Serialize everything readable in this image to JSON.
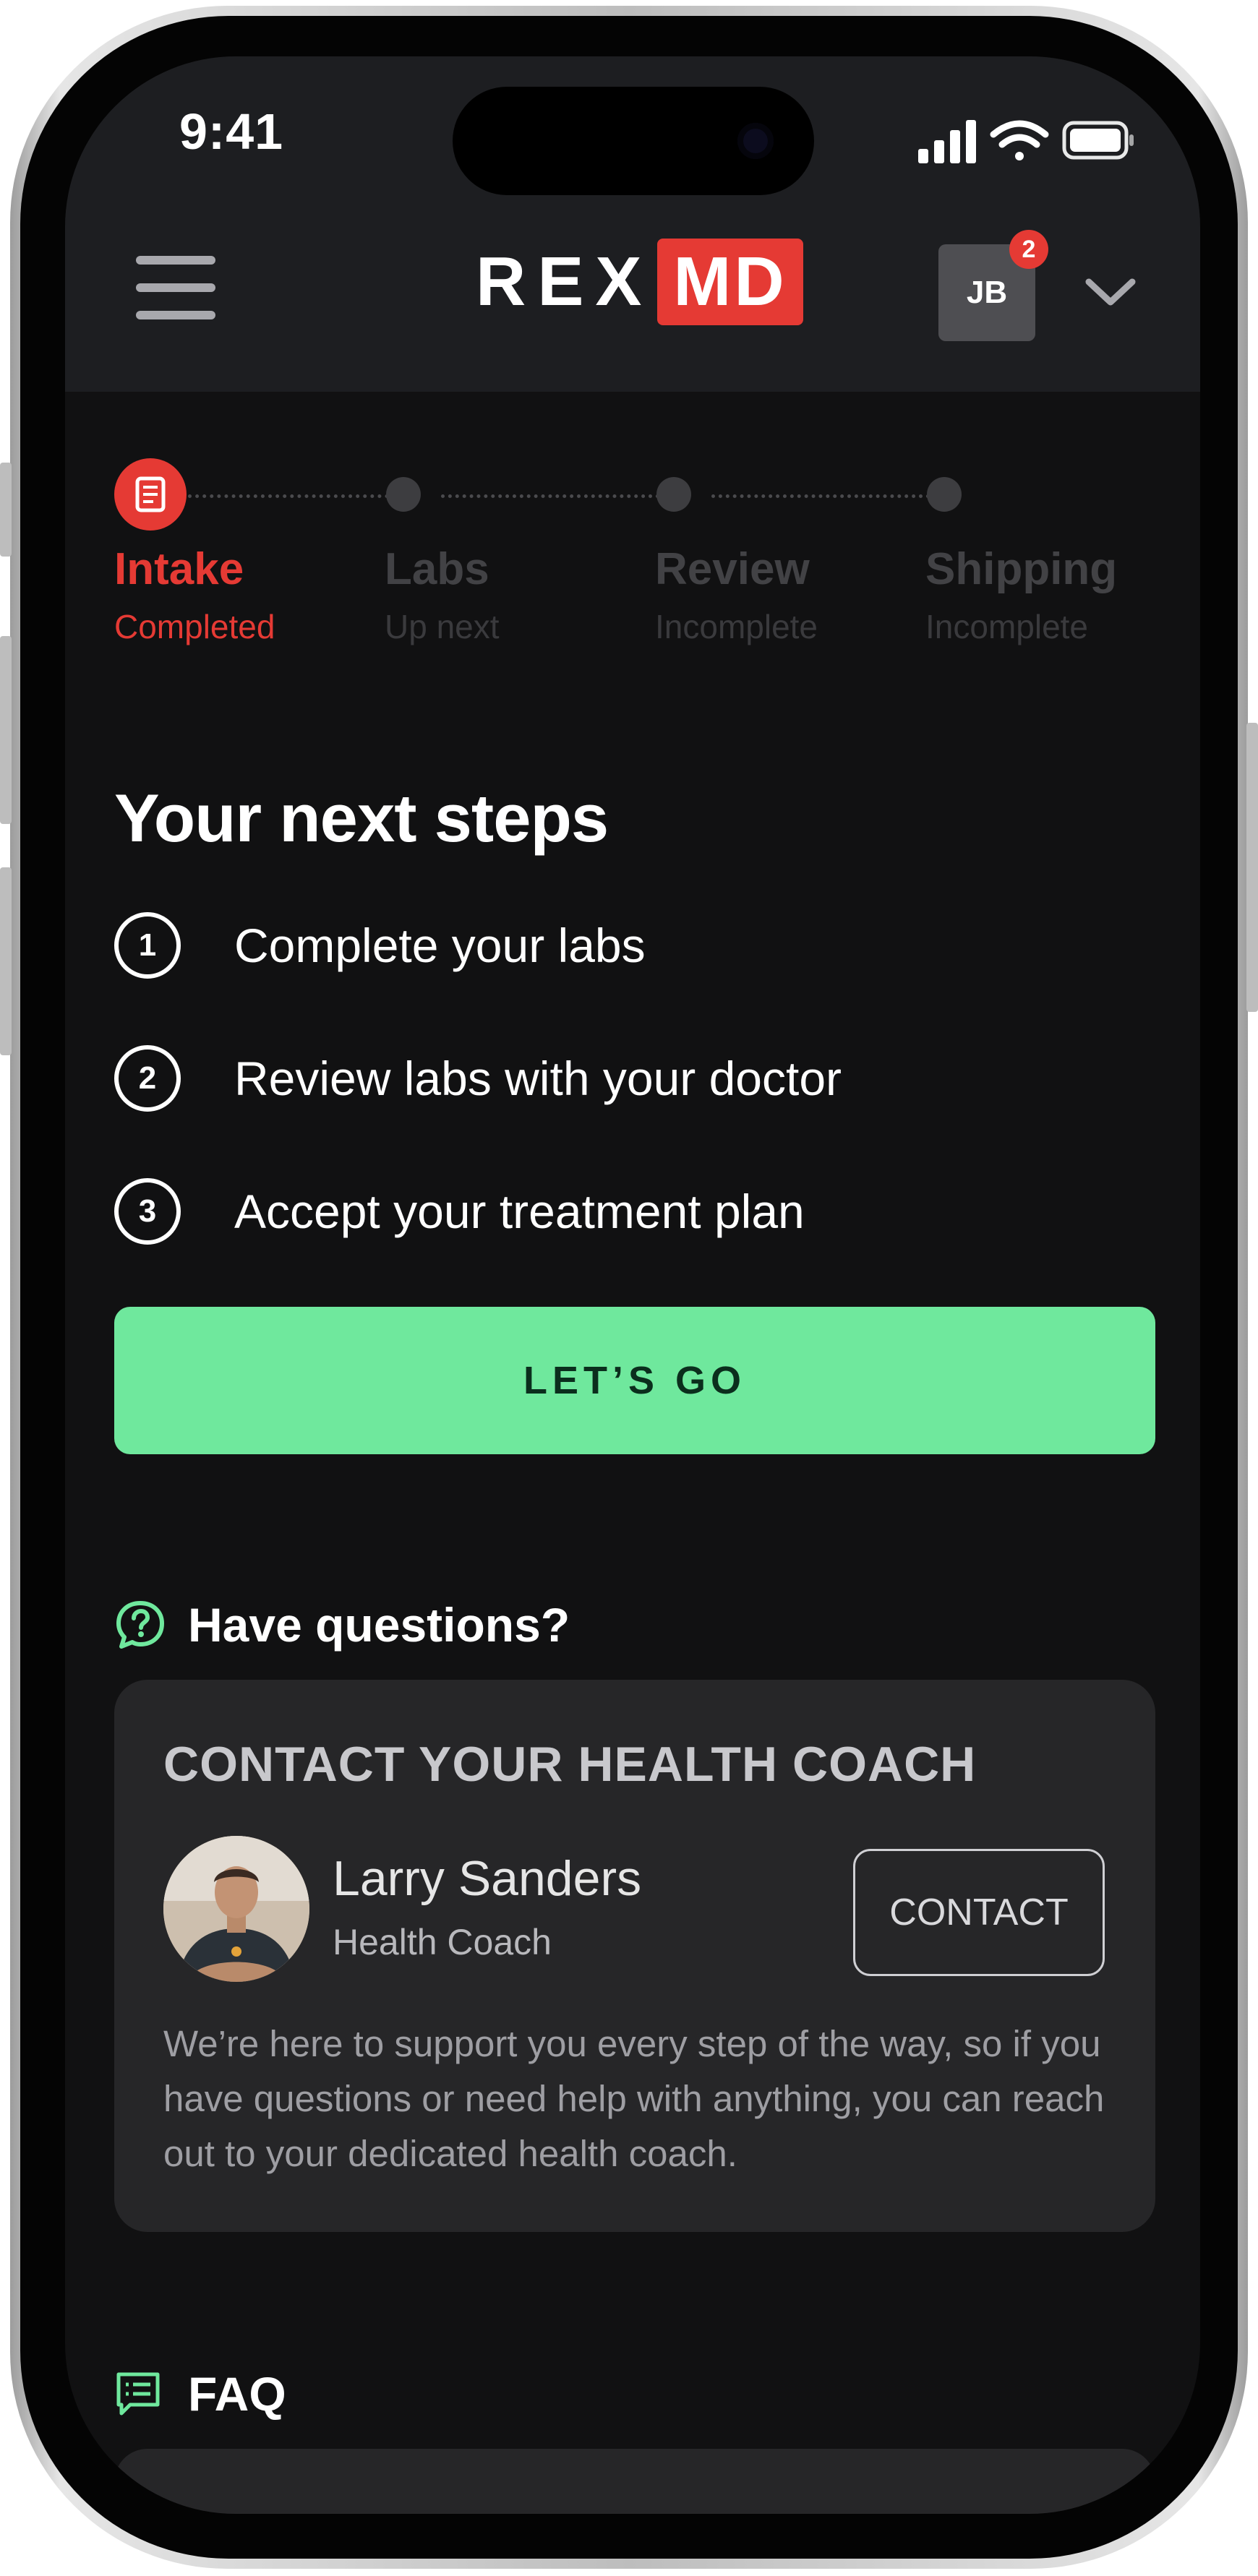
{
  "status_bar": {
    "time": "9:41"
  },
  "header": {
    "brand_left": "REX",
    "brand_right": "MD",
    "avatar_initials": "JB",
    "notification_count": "2"
  },
  "progress": {
    "steps": [
      {
        "label": "Intake",
        "status": "Completed",
        "active": true
      },
      {
        "label": "Labs",
        "status": "Up next",
        "active": false
      },
      {
        "label": "Review",
        "status": "Incomplete",
        "active": false
      },
      {
        "label": "Shipping",
        "status": "Incomplete",
        "active": false
      }
    ]
  },
  "next_steps": {
    "title": "Your next steps",
    "items": [
      {
        "number": "1",
        "text": "Complete your labs"
      },
      {
        "number": "2",
        "text": "Review labs with your doctor"
      },
      {
        "number": "3",
        "text": "Accept your treatment plan"
      }
    ],
    "cta_label": "LET’S GO"
  },
  "questions": {
    "label": "Have questions?",
    "card_title": "CONTACT YOUR HEALTH COACH",
    "coach_name": "Larry Sanders",
    "coach_role": "Health Coach",
    "contact_label": "CONTACT",
    "body": "We’re here to support you every step of the way, so if you have questions or need help with anything, you can reach out to your dedicated health coach."
  },
  "faq": {
    "label": "FAQ"
  },
  "colors": {
    "accent_red": "#e53a34",
    "cta_green": "#6fe89d",
    "icon_green": "#6fe89d",
    "background": "#111112"
  }
}
